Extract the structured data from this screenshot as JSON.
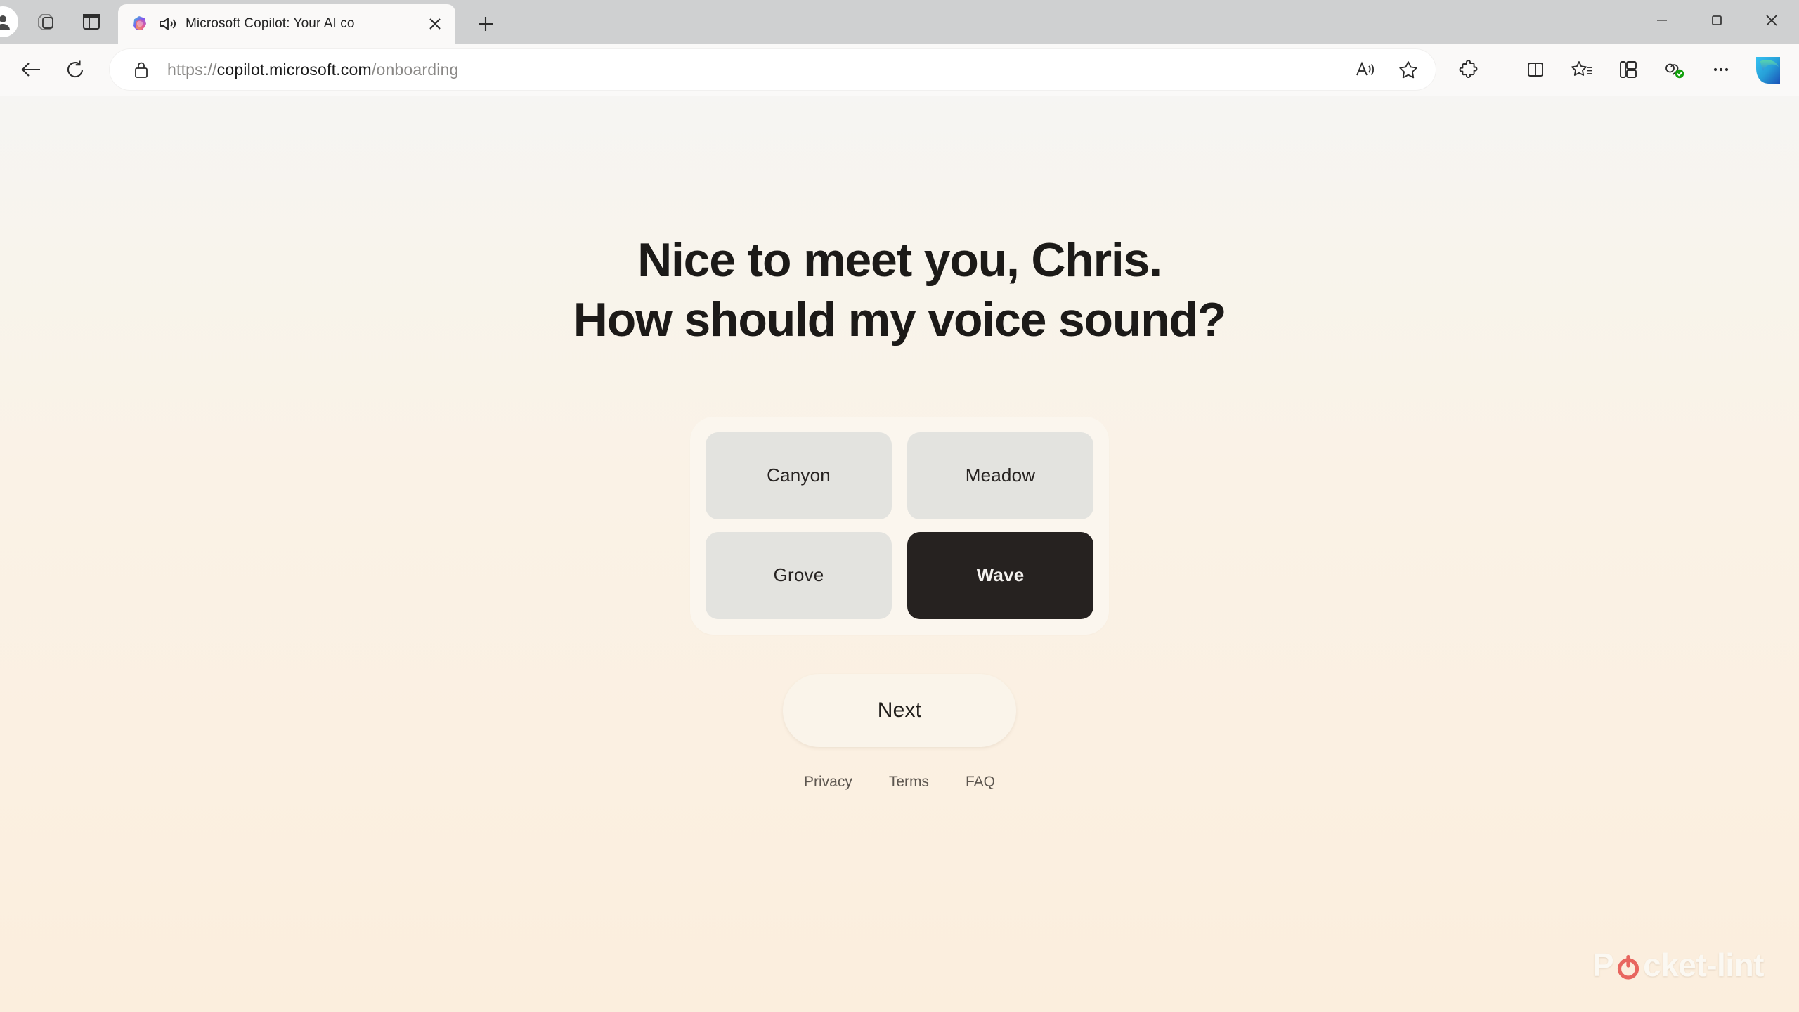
{
  "browser": {
    "tab": {
      "title": "Microsoft Copilot: Your AI co",
      "favicon": "copilot-favicon",
      "audio_icon": "speaker-playing-icon",
      "close_icon": "close-icon"
    },
    "new_tab_label": "+",
    "window_controls": {
      "minimize": "minimize-icon",
      "maximize": "maximize-icon",
      "close": "close-icon"
    },
    "left_icons": [
      "profile-avatar",
      "workspaces-cube-icon",
      "tab-actions-icon"
    ],
    "nav": {
      "back": "back-arrow-icon",
      "reload": "reload-icon"
    },
    "address": {
      "lock_icon": "lock-icon",
      "scheme": "https://",
      "host": "copilot.microsoft.com",
      "path": "/onboarding",
      "full_url": "https://copilot.microsoft.com/onboarding",
      "read_aloud_icon": "read-aloud-icon",
      "favorite_icon": "star-icon"
    },
    "toolbar_icons": [
      "extensions-icon",
      "split-screen-icon",
      "collections-icon",
      "browser-essentials-icon",
      "copilot-shield-icon",
      "settings-more-icon",
      "edge-sidebar-icon"
    ]
  },
  "page": {
    "headline": {
      "line1": "Nice to meet you, Chris.",
      "line2": "How should my voice sound?"
    },
    "voices": [
      {
        "label": "Canyon",
        "selected": false
      },
      {
        "label": "Meadow",
        "selected": false
      },
      {
        "label": "Grove",
        "selected": false
      },
      {
        "label": "Wave",
        "selected": true
      }
    ],
    "next_label": "Next",
    "footer": [
      {
        "label": "Privacy"
      },
      {
        "label": "Terms"
      },
      {
        "label": "FAQ"
      }
    ],
    "watermark": {
      "prefix": "P",
      "suffix": "cket-lint"
    }
  },
  "colors": {
    "selected_card": "#262220",
    "card": "#e3e3df",
    "panel": "#fbf6ee",
    "watermark_accent": "#e8665f",
    "page_bg_top": "#f6f5f3",
    "page_bg_bottom": "#fbeedd"
  }
}
